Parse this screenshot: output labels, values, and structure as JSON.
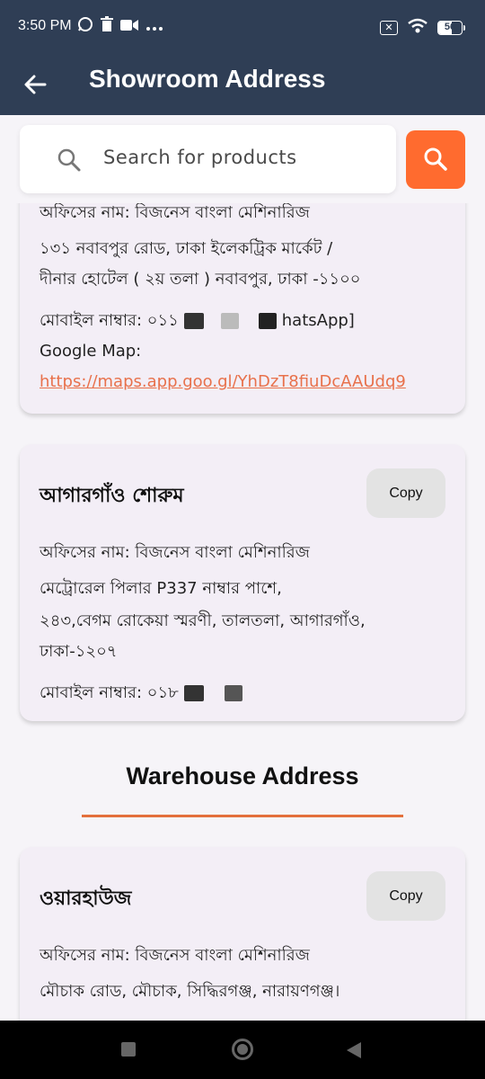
{
  "status_bar": {
    "time": "3:50 PM",
    "icons": [
      "whatsapp-icon",
      "trash-icon",
      "video-icon",
      "more-icon"
    ],
    "battery": "56",
    "battery_level": 0.56
  },
  "app_bar": {
    "title": "Showroom Address",
    "back_icon": "arrow-left-icon"
  },
  "search": {
    "placeholder": "Search for products",
    "icon": "search-icon",
    "button_icon": "search-icon",
    "accent_color": "#ff6b2f"
  },
  "showroom_partial": {
    "office_name": "অফিসের নাম: বিজনেস বাংলা মেশিনারিজ",
    "address_line1": "১৩১ নবাবপুর রোড, ঢাকা ইলেকট্রিক মার্কেট /",
    "address_line2": "দীনার হোটেল ( ২য় তলা ) নবাবপুর, ঢাকা -১১০০",
    "mobile_label": "মোবাইল নাম্বার:",
    "mobile_visible": "০১১",
    "mobile_suffix": "hatsApp]",
    "map_label": "Google Map:",
    "map_link": "https://maps.app.goo.gl/YhDzT8fiuDcAAUdq9"
  },
  "showroom_agargaon": {
    "title": "আগারগাঁও শোরুম",
    "copy_label": "Copy",
    "office_name": "অফিসের নাম: বিজনেস বাংলা মেশিনারিজ",
    "address_line1": "মেট্রোরেল পিলার P337 নাম্বার পাশে,",
    "address_line2": "২৪৩,বেগম রোকেয়া স্মরণী, তালতলা, আগারগাঁও,",
    "address_line3": "ঢাকা-১২০৭",
    "mobile_label": "মোবাইল নাম্বার:",
    "mobile_visible": "০১৮"
  },
  "warehouse_section": {
    "heading": "Warehouse Address",
    "rule_color": "#e3703c"
  },
  "warehouse": {
    "title": "ওয়ারহাউজ",
    "copy_label": "Copy",
    "office_name": "অফিসের নাম: বিজনেস বাংলা মেশিনারিজ",
    "address_line1": "মৌচাক রোড, মৌচাক, সিদ্ধিরগঞ্জ, নারায়ণগঞ্জ।"
  },
  "nav_bar": {
    "recent": "recent-apps-icon",
    "home": "home-icon",
    "back": "back-icon"
  }
}
